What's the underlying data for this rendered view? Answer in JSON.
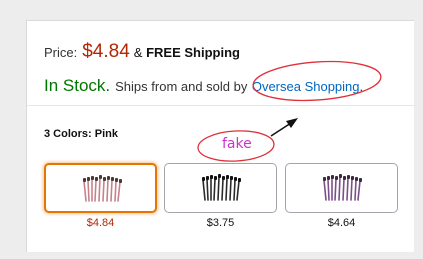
{
  "price": {
    "label": "Price:",
    "value": "$4.84",
    "shipping_prefix": "&",
    "shipping": "FREE Shipping"
  },
  "stock": {
    "status": "In Stock.",
    "text": "Ships from and sold by",
    "seller": "Oversea Shopping",
    "period": "."
  },
  "colors": {
    "heading": "3 Colors:",
    "selected_name": "Pink",
    "options": [
      {
        "price": "$4.84",
        "color": "#c6828a",
        "selected": true
      },
      {
        "price": "$3.75",
        "color": "#2b2b2b",
        "selected": false
      },
      {
        "price": "$4.64",
        "color": "#7b4f8a",
        "selected": false
      }
    ]
  },
  "annotation": {
    "text": "fake",
    "color": "#cc33cc"
  }
}
